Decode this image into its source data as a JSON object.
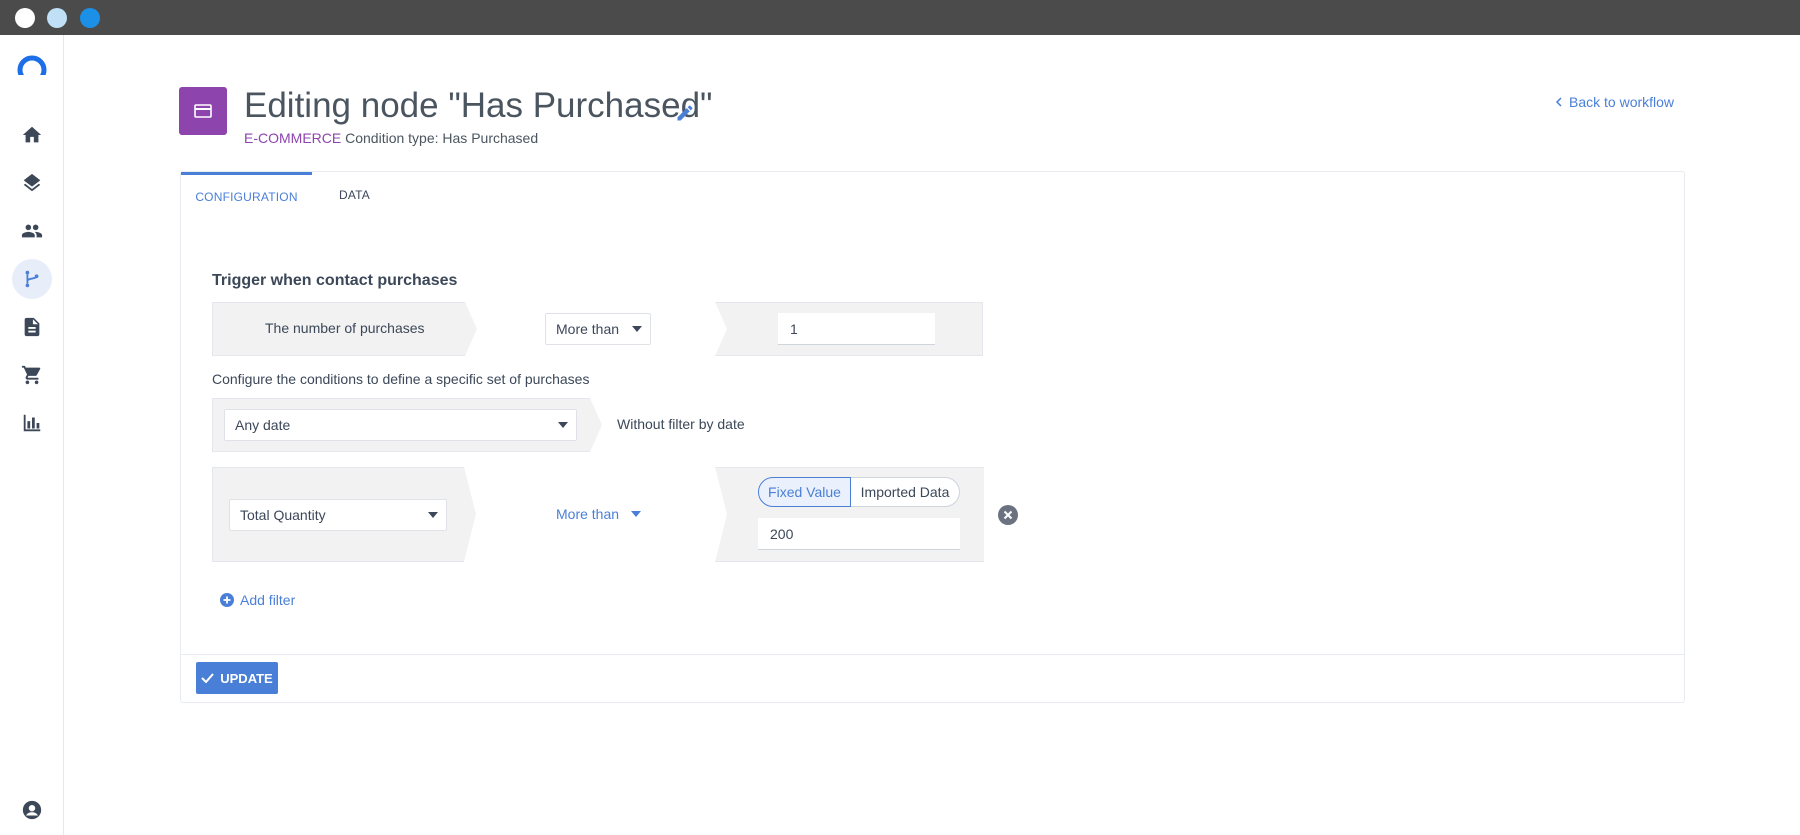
{
  "window": {
    "dots": [
      "#ffffff",
      "#bfe0f7",
      "#1c8fe6"
    ]
  },
  "sidebar": {
    "items": [
      {
        "icon": "home-icon"
      },
      {
        "icon": "layers-icon"
      },
      {
        "icon": "people-icon"
      },
      {
        "icon": "workflow-icon",
        "active": true
      },
      {
        "icon": "document-icon"
      },
      {
        "icon": "cart-icon"
      },
      {
        "icon": "chart-icon"
      }
    ],
    "account_icon": "account-icon"
  },
  "header": {
    "title": "Editing node \"Has Purchased\"",
    "category": "E-COMMERCE",
    "condition_text": "Condition type: Has Purchased",
    "back_link": "Back to workflow"
  },
  "tabs": [
    {
      "label": "CONFIGURATION",
      "active": true
    },
    {
      "label": "DATA",
      "active": false
    }
  ],
  "form": {
    "section_title": "Trigger when contact purchases",
    "purchases_row": {
      "label": "The number of purchases",
      "operator": "More than",
      "value": "1"
    },
    "conditions_note": "Configure the conditions to define a specific set of purchases",
    "date_row": {
      "date_select": "Any date",
      "date_text": "Without filter by date"
    },
    "filter_row": {
      "field_select": "Total Quantity",
      "operator": "More than",
      "toggle_fixed": "Fixed Value",
      "toggle_imported": "Imported Data",
      "value": "200"
    },
    "add_filter": "Add filter"
  },
  "footer": {
    "update_label": "UPDATE"
  },
  "colors": {
    "accent": "#4a7fd8",
    "brand_purple": "#8e44ad"
  }
}
